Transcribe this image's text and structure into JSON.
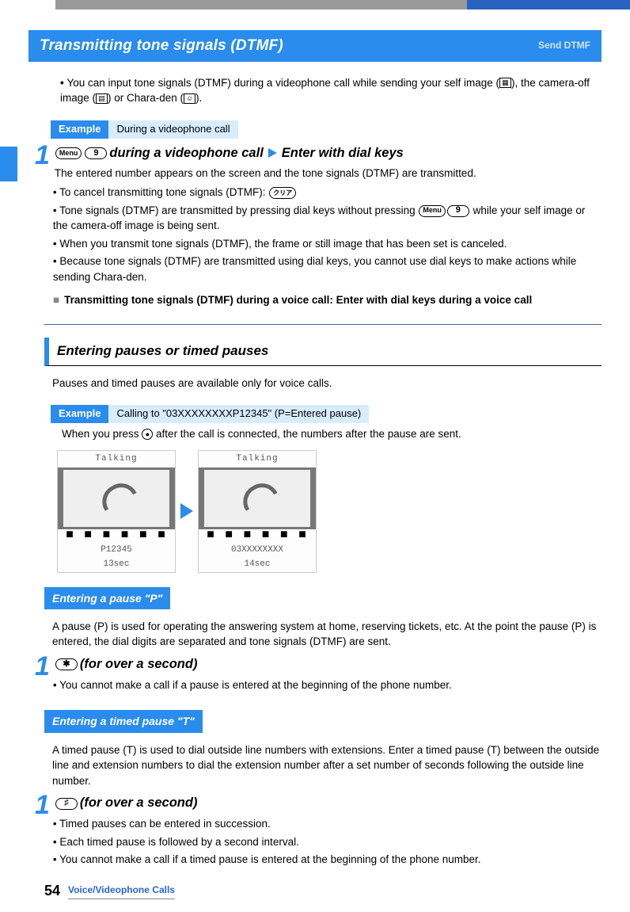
{
  "header": {
    "title": "Transmitting tone signals (DTMF)",
    "label": "Send DTMF"
  },
  "intro": {
    "line1a": "You can input tone signals (DTMF) during a videophone call while sending your self image (",
    "line1b": "), the camera-off image (",
    "line1c": ") or Chara-den (",
    "line1d": ")."
  },
  "example1": {
    "badge": "Example",
    "text": "During a videophone call"
  },
  "step1": {
    "num": "1",
    "key_menu": "Menu",
    "key_nine": "9",
    "title_mid": " during a videophone call ",
    "title_after": " Enter with dial keys",
    "desc": "The entered number appears on the screen and the tone signals (DTMF) are transmitted.",
    "b1": "To cancel transmitting tone signals (DTMF): ",
    "key_clear": "クリア",
    "b2a": "Tone signals (DTMF) are transmitted by pressing dial keys without pressing ",
    "b2b": " while your self image or the camera-off image is being sent.",
    "b3": "When you transmit tone signals (DTMF), the frame or still image that has been set is canceled.",
    "b4": "Because tone signals (DTMF) are transmitted using dial keys, you cannot use dial keys to make actions while sending Chara-den.",
    "note": "Transmitting tone signals (DTMF) during a voice call: Enter with dial keys during a voice call"
  },
  "section2": {
    "title": "Entering pauses or timed pauses",
    "desc": "Pauses and timed pauses are available only for voice calls."
  },
  "example2": {
    "badge": "Example",
    "text": "Calling to \"03XXXXXXXXP12345\" (P=Entered pause)"
  },
  "afterExample2a": "When you press ",
  "afterExample2b": " after the call is connected, the numbers after the pause are sent.",
  "phone1": {
    "status": "Talking",
    "num": "P12345",
    "time": "13sec"
  },
  "phone2": {
    "status": "Talking",
    "num": "03XXXXXXXX",
    "time": "14sec"
  },
  "sub_p": {
    "title": "Entering a pause \"P\"",
    "desc": "A pause (P) is used for operating the answering system at home, reserving tickets, etc. At the point the pause (P) is entered, the dial digits are separated and tone signals (DTMF) are sent."
  },
  "step_p": {
    "num": "1",
    "key": "✱",
    "title": " (for over a second)",
    "b1": "You cannot make a call if a pause is entered at the beginning of the phone number."
  },
  "sub_t": {
    "title": "Entering a timed pause \"T\"",
    "desc": "A timed pause (T) is used to dial outside line numbers with extensions. Enter a timed pause (T) between the outside line and extension numbers to dial the extension number after a set number of seconds following the outside line number."
  },
  "step_t": {
    "num": "1",
    "key": "♯",
    "title": " (for over a second)",
    "b1": "Timed pauses can be entered in succession.",
    "b2": "Each timed pause is followed by a second interval.",
    "b3": "You cannot make a call if a timed pause is entered at the beginning of the phone number."
  },
  "footer": {
    "page": "54",
    "label": "Voice/Videophone Calls"
  }
}
